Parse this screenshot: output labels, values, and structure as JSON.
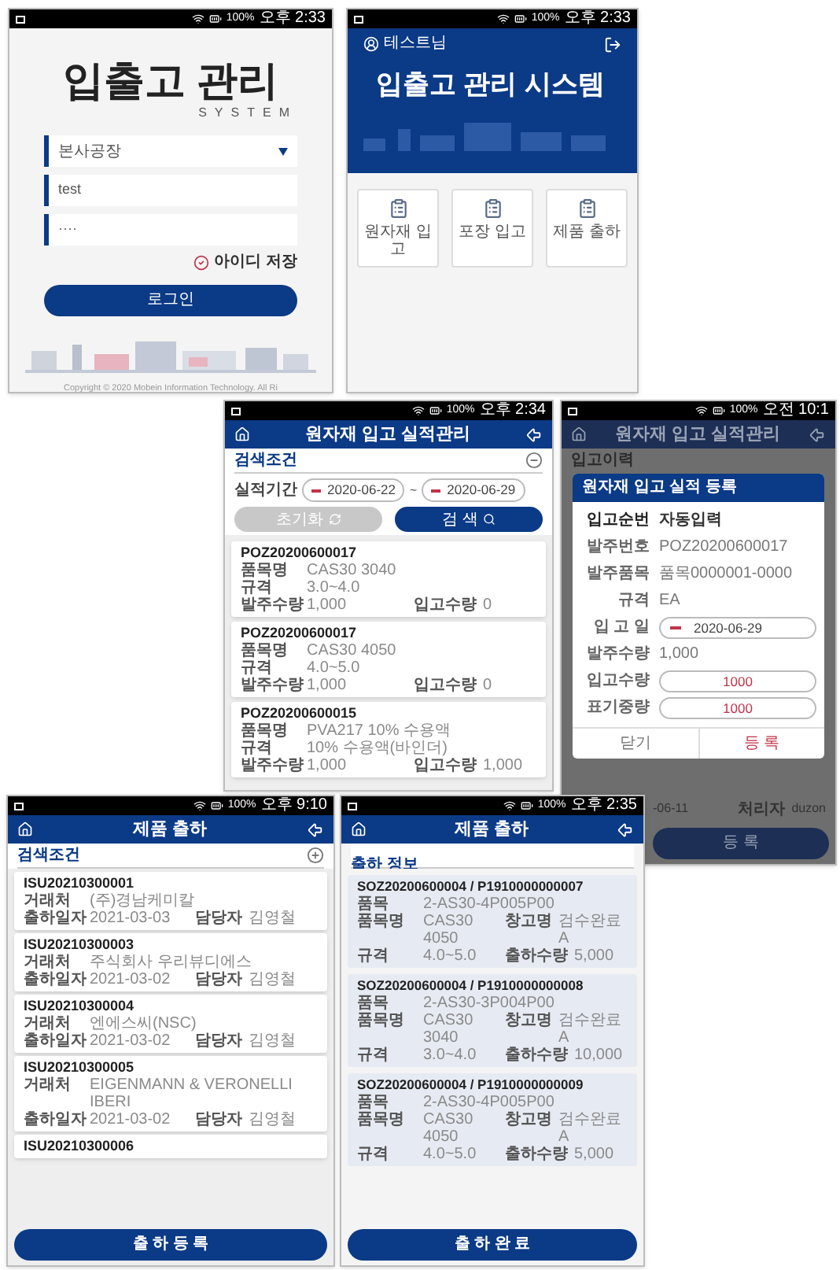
{
  "screens": [
    {
      "kind": "login",
      "status": {
        "battery": "100%",
        "time": "오후 2:33"
      },
      "title": "입출고 관리",
      "subtitle": "SYSTEM",
      "plant_select": {
        "value": "본사공장"
      },
      "user_field": {
        "value": "test"
      },
      "password_field": {
        "value": "····"
      },
      "remember": {
        "label": "아이디 저장",
        "checked": true
      },
      "login_button": "로그인",
      "copyright": "Copyright © 2020 Mobein Information Technology. All Ri"
    },
    {
      "kind": "home",
      "status": {
        "battery": "100%",
        "time": "오후 2:33"
      },
      "user": "테스트님",
      "title": "입출고 관리 시스템",
      "menu": [
        {
          "label": "원자재 입고"
        },
        {
          "label": "포장 입고"
        },
        {
          "label": "제품 출하"
        }
      ]
    },
    {
      "kind": "receipt_list",
      "status": {
        "battery": "100%",
        "time": "오후 2:34"
      },
      "title": "원자재 입고 실적관리",
      "search": {
        "label": "검색조건",
        "expanded": true
      },
      "period": {
        "label": "실적기간",
        "from": "2020-06-22",
        "separator": "~",
        "to": "2020-06-29"
      },
      "reset_button": {
        "label": "초기화",
        "disabled": true
      },
      "search_button": "검 색",
      "items": [
        {
          "id": "POZ20200600017",
          "rows": [
            {
              "cells": [
                {
                  "label": "품목명",
                  "value": "CAS30 3040"
                }
              ]
            },
            {
              "cells": [
                {
                  "label": "규격",
                  "value": "3.0~4.0"
                }
              ]
            },
            {
              "cells": [
                {
                  "label": "발주수량",
                  "value": "1,000"
                },
                {
                  "label": "입고수량",
                  "value": "0"
                }
              ]
            }
          ]
        },
        {
          "id": "POZ20200600017",
          "rows": [
            {
              "cells": [
                {
                  "label": "품목명",
                  "value": "CAS30 4050"
                }
              ]
            },
            {
              "cells": [
                {
                  "label": "규격",
                  "value": "4.0~5.0"
                }
              ]
            },
            {
              "cells": [
                {
                  "label": "발주수량",
                  "value": "1,000"
                },
                {
                  "label": "입고수량",
                  "value": "0"
                }
              ]
            }
          ]
        },
        {
          "id": "POZ20200600015",
          "rows": [
            {
              "cells": [
                {
                  "label": "품목명",
                  "value": "PVA217 10% 수용액"
                }
              ]
            },
            {
              "cells": [
                {
                  "label": "규격",
                  "value": "10% 수용액(바인더)"
                }
              ]
            },
            {
              "cells": [
                {
                  "label": "발주수량",
                  "value": "1,000"
                },
                {
                  "label": "입고수량",
                  "value": "1,000"
                }
              ]
            }
          ]
        }
      ]
    },
    {
      "kind": "receipt_dialog",
      "status": {
        "battery": "100%",
        "time": "오전 10:1"
      },
      "title": "원자재 입고 실적관리",
      "section": "입고이력",
      "dialog": {
        "title": "원자재 입고 실적 등록",
        "rows": [
          {
            "kind": "bold",
            "label": "입고순번",
            "value": "자동입력"
          },
          {
            "kind": "text",
            "label": "발주번호",
            "value": "POZ20200600017"
          },
          {
            "kind": "text",
            "label": "발주품목",
            "value": "품목0000001-0000"
          },
          {
            "kind": "text",
            "label": "규격",
            "value": "EA"
          },
          {
            "kind": "date",
            "label": "입 고 일",
            "value": "2020-06-29"
          },
          {
            "kind": "text",
            "label": "발주수량",
            "value": "1,000"
          },
          {
            "kind": "input",
            "label": "입고수량",
            "value": "1000"
          },
          {
            "kind": "input",
            "label": "표기중량",
            "value": "1000"
          }
        ],
        "cancel": "닫기",
        "confirm": "등 록"
      },
      "footer_row": {
        "date": "-06-11",
        "handler_label": "처리자",
        "handler": "duzon"
      },
      "footer_button": "등 록"
    },
    {
      "kind": "shipment_list",
      "status": {
        "battery": "100%",
        "time": "오후 9:10"
      },
      "title": "제품 출하",
      "search": {
        "label": "검색조건",
        "expanded": false
      },
      "items": [
        {
          "id": "ISU20210300001",
          "rows": [
            {
              "cells": [
                {
                  "label": "거래처",
                  "value": "(주)경남케미칼"
                }
              ]
            },
            {
              "cells": [
                {
                  "label": "출하일자",
                  "value": "2021-03-03"
                },
                {
                  "label": "담당자",
                  "value": "김영철"
                }
              ]
            }
          ]
        },
        {
          "id": "ISU20210300003",
          "rows": [
            {
              "cells": [
                {
                  "label": "거래처",
                  "value": "주식회사 우리뷰디에스"
                }
              ]
            },
            {
              "cells": [
                {
                  "label": "출하일자",
                  "value": "2021-03-02"
                },
                {
                  "label": "담당자",
                  "value": "김영철"
                }
              ]
            }
          ]
        },
        {
          "id": "ISU20210300004",
          "rows": [
            {
              "cells": [
                {
                  "label": "거래처",
                  "value": "엔에스씨(NSC)"
                }
              ]
            },
            {
              "cells": [
                {
                  "label": "출하일자",
                  "value": "2021-03-02"
                },
                {
                  "label": "담당자",
                  "value": "김영철"
                }
              ]
            }
          ]
        },
        {
          "id": "ISU20210300005",
          "rows": [
            {
              "cells": [
                {
                  "label": "거래처",
                  "value": "EIGENMANN & VERONELLI IBERI"
                }
              ]
            },
            {
              "cells": [
                {
                  "label": "출하일자",
                  "value": "2021-03-02"
                },
                {
                  "label": "담당자",
                  "value": "김영철"
                }
              ]
            }
          ]
        },
        {
          "id": "ISU20210300006"
        }
      ],
      "button": "출 하 등 록"
    },
    {
      "kind": "shipment_detail",
      "status": {
        "battery": "100%",
        "time": "오후 2:35"
      },
      "title": "제품 출하",
      "section": "출하 정보",
      "items": [
        {
          "id": "SOZ20200600004 / P1910000000007",
          "rows": [
            {
              "cells": [
                {
                  "label": "품목",
                  "value": "2-AS30-4P005P00"
                }
              ]
            },
            {
              "cells": [
                {
                  "label": "품목명",
                  "value": "CAS30 4050"
                },
                {
                  "label": "창고명",
                  "value": "검수완료A"
                }
              ]
            },
            {
              "cells": [
                {
                  "label": "규격",
                  "value": "4.0~5.0"
                },
                {
                  "label": "출하수량",
                  "value": "5,000"
                }
              ]
            }
          ]
        },
        {
          "id": "SOZ20200600004 / P1910000000008",
          "rows": [
            {
              "cells": [
                {
                  "label": "품목",
                  "value": "2-AS30-3P004P00"
                }
              ]
            },
            {
              "cells": [
                {
                  "label": "품목명",
                  "value": "CAS30 3040"
                },
                {
                  "label": "창고명",
                  "value": "검수완료A"
                }
              ]
            },
            {
              "cells": [
                {
                  "label": "규격",
                  "value": "3.0~4.0"
                },
                {
                  "label": "출하수량",
                  "value": "10,000"
                }
              ]
            }
          ]
        },
        {
          "id": "SOZ20200600004 / P1910000000009",
          "rows": [
            {
              "cells": [
                {
                  "label": "품목",
                  "value": "2-AS30-4P005P00"
                }
              ]
            },
            {
              "cells": [
                {
                  "label": "품목명",
                  "value": "CAS30 4050"
                },
                {
                  "label": "창고명",
                  "value": "검수완료A"
                }
              ]
            },
            {
              "cells": [
                {
                  "label": "규격",
                  "value": "4.0~5.0"
                },
                {
                  "label": "출하수량",
                  "value": "5,000"
                }
              ]
            }
          ]
        }
      ],
      "button": "출 하 완 료"
    }
  ]
}
